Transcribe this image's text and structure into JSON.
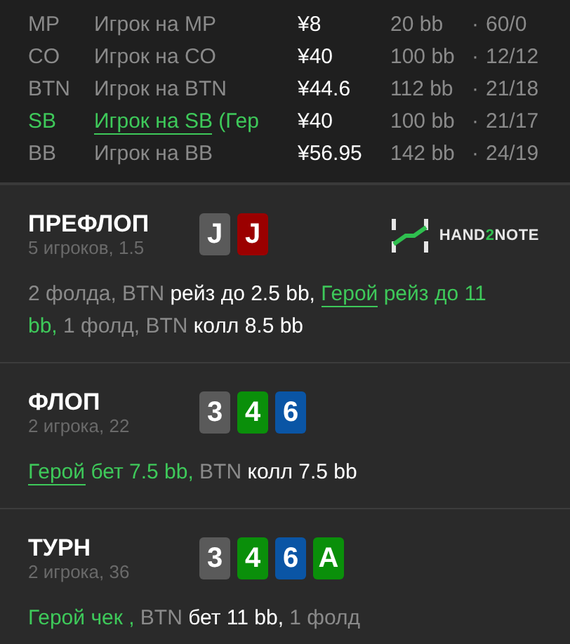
{
  "players": [
    {
      "position": "MP",
      "name": "Игрок на MP",
      "stack": "¥8",
      "bb": "20 bb",
      "dot": "·",
      "stats": "60/0",
      "hero": false
    },
    {
      "position": "CO",
      "name": "Игрок на CO",
      "stack": "¥40",
      "bb": "100 bb",
      "dot": "·",
      "stats": "12/12",
      "hero": false
    },
    {
      "position": "BTN",
      "name": "Игрок на BTN",
      "stack": "¥44.6",
      "bb": "112 bb",
      "dot": "·",
      "stats": "21/18",
      "hero": false
    },
    {
      "position": "SB",
      "name": "Игрок на SB",
      "name_suffix": " (Гер",
      "stack": "¥40",
      "bb": "100 bb",
      "dot": "·",
      "stats": "21/17",
      "hero": true
    },
    {
      "position": "BB",
      "name": "Игрок на BB",
      "stack": "¥56.95",
      "bb": "142 bb",
      "dot": "·",
      "stats": "24/19",
      "hero": false
    }
  ],
  "logo": {
    "parts": [
      {
        "text": "HAND",
        "accent": false
      },
      {
        "text": "2",
        "accent": true
      },
      {
        "text": "NOTE",
        "accent": false
      }
    ]
  },
  "streets": [
    {
      "title": "ПРЕФЛОП",
      "subtitle": "5 игроков, 1.5",
      "show_logo": true,
      "cards": [
        {
          "rank": "J",
          "color": "#5a5a5a"
        },
        {
          "rank": "J",
          "color": "#9b0000"
        }
      ],
      "actions": [
        {
          "kind": "plain",
          "text": "2 фолда, BTN "
        },
        {
          "kind": "bold",
          "text": "рейз до 2.5 bb, "
        },
        {
          "kind": "hero",
          "text": "Герой"
        },
        {
          "kind": "hero-action",
          "text": " рейз до 11 bb,"
        },
        {
          "kind": "plain",
          "text": " 1 фолд, BTN "
        },
        {
          "kind": "bold",
          "text": "колл 8.5 bb"
        }
      ]
    },
    {
      "title": "ФЛОП",
      "subtitle": "2 игрока, 22",
      "show_logo": false,
      "cards": [
        {
          "rank": "3",
          "color": "#5a5a5a"
        },
        {
          "rank": "4",
          "color": "#0a8f0a"
        },
        {
          "rank": "6",
          "color": "#0a55a5"
        }
      ],
      "actions": [
        {
          "kind": "hero",
          "text": "Герой"
        },
        {
          "kind": "hero-action",
          "text": " бет 7.5 bb,"
        },
        {
          "kind": "plain",
          "text": " BTN "
        },
        {
          "kind": "bold",
          "text": "колл 7.5 bb"
        }
      ]
    },
    {
      "title": "ТУРН",
      "subtitle": "2 игрока, 36",
      "show_logo": false,
      "cards": [
        {
          "rank": "3",
          "color": "#5a5a5a"
        },
        {
          "rank": "4",
          "color": "#0a8f0a"
        },
        {
          "rank": "6",
          "color": "#0a55a5"
        },
        {
          "rank": "A",
          "color": "#0a8f0a"
        }
      ],
      "actions": [
        {
          "kind": "hero-action",
          "text": "Герой чек ,"
        },
        {
          "kind": "plain",
          "text": " BTN "
        },
        {
          "kind": "bold",
          "text": "бет 11 bb,"
        },
        {
          "kind": "plain",
          "text": " 1 фолд"
        }
      ]
    }
  ]
}
